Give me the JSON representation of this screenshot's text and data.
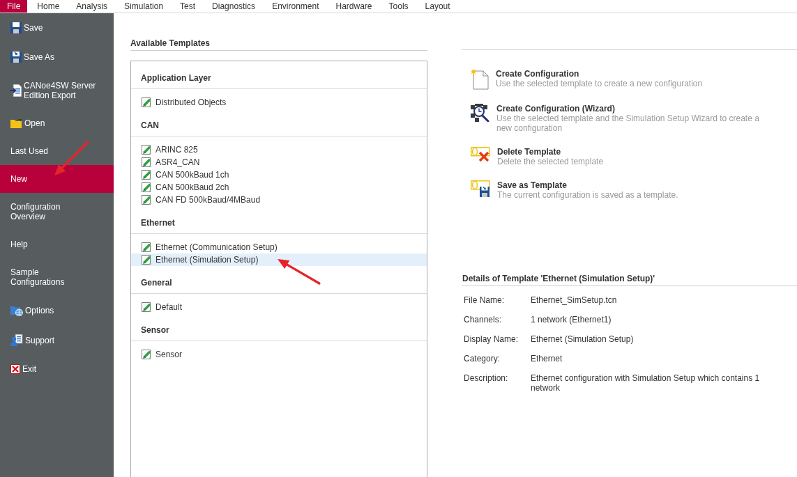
{
  "menu_bar": {
    "tabs": [
      {
        "label": "File",
        "selected": true
      },
      {
        "label": "Home",
        "selected": false
      },
      {
        "label": "Analysis",
        "selected": false
      },
      {
        "label": "Simulation",
        "selected": false
      },
      {
        "label": "Test",
        "selected": false
      },
      {
        "label": "Diagnostics",
        "selected": false
      },
      {
        "label": "Environment",
        "selected": false
      },
      {
        "label": "Hardware",
        "selected": false
      },
      {
        "label": "Tools",
        "selected": false
      },
      {
        "label": "Layout",
        "selected": false
      }
    ]
  },
  "sidebar": {
    "items": [
      {
        "label": "Save",
        "selected": false
      },
      {
        "label": "Save As",
        "selected": false
      },
      {
        "label": "CANoe4SW Server Edition Export",
        "selected": false
      },
      {
        "label": "Open",
        "selected": false
      },
      {
        "label": "Last Used",
        "selected": false
      },
      {
        "label": "New",
        "selected": true
      },
      {
        "label": "Configuration Overview",
        "selected": false
      },
      {
        "label": "Help",
        "selected": false
      },
      {
        "label": "Sample Configurations",
        "selected": false
      },
      {
        "label": "Options",
        "selected": false
      },
      {
        "label": "Support",
        "selected": false
      },
      {
        "label": "Exit",
        "selected": false
      }
    ]
  },
  "templates": {
    "title": "Available Templates",
    "groups": [
      {
        "name": "Application Layer",
        "items": [
          {
            "label": "Distributed Objects",
            "selected": false
          }
        ]
      },
      {
        "name": "CAN",
        "items": [
          {
            "label": "ARINC 825",
            "selected": false
          },
          {
            "label": "ASR4_CAN",
            "selected": false
          },
          {
            "label": "CAN 500kBaud 1ch",
            "selected": false
          },
          {
            "label": "CAN 500kBaud 2ch",
            "selected": false
          },
          {
            "label": "CAN FD 500kBaud/4MBaud",
            "selected": false
          }
        ]
      },
      {
        "name": "Ethernet",
        "items": [
          {
            "label": "Ethernet (Communication Setup)",
            "selected": false
          },
          {
            "label": "Ethernet (Simulation Setup)",
            "selected": true
          }
        ]
      },
      {
        "name": "General",
        "items": [
          {
            "label": "Default",
            "selected": false
          }
        ]
      },
      {
        "name": "Sensor",
        "items": [
          {
            "label": "Sensor",
            "selected": false
          }
        ]
      }
    ]
  },
  "actions": [
    {
      "title": "Create Configuration",
      "description": "Use the selected template to create a new configuration"
    },
    {
      "title": "Create Configuration (Wizard)",
      "description": "Use the selected template and the Simulation Setup Wizard to create a new configuration"
    },
    {
      "title": "Delete Template",
      "description": "Delete the selected template"
    },
    {
      "title": "Save as Template",
      "description": "The current configuration is saved as a template."
    }
  ],
  "details": {
    "title": "Details of Template 'Ethernet (Simulation Setup)'",
    "rows": [
      {
        "label": "File Name:",
        "value": "Ethernet_SimSetup.tcn"
      },
      {
        "label": "Channels:",
        "value": "1 network (Ethernet1)"
      },
      {
        "label": "Display Name:",
        "value": "Ethernet (Simulation Setup)"
      },
      {
        "label": "Category:",
        "value": "Ethernet"
      },
      {
        "label": "Description:",
        "value": "Ethernet configuration with Simulation Setup which contains 1 network"
      }
    ]
  }
}
